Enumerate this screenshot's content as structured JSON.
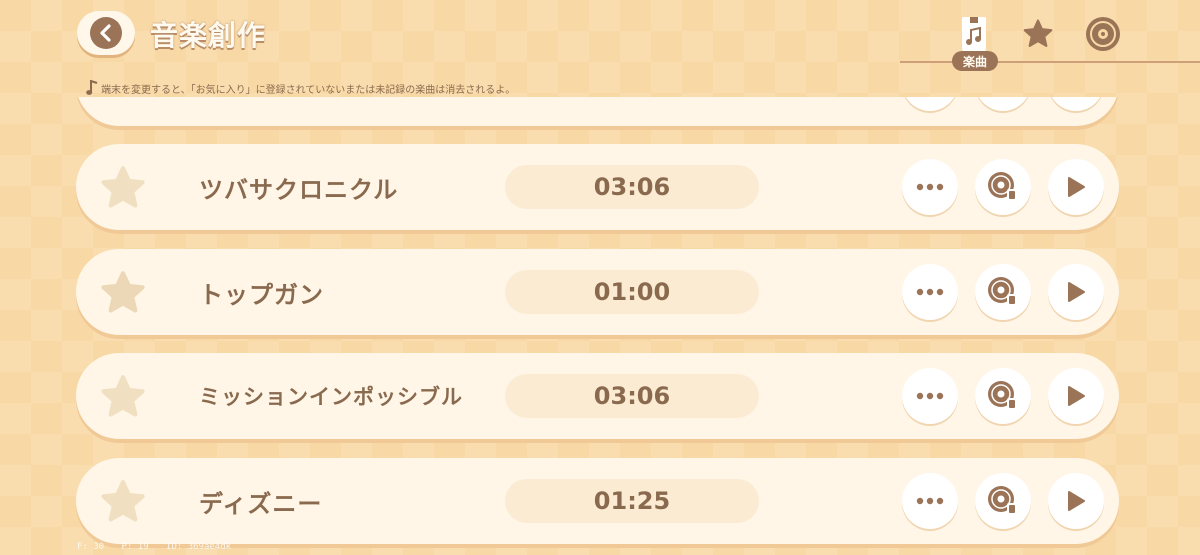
{
  "header": {
    "title": "音楽創作",
    "back_icon": "chevron-left-icon"
  },
  "tabs": [
    {
      "name": "songs",
      "icon": "music-file-icon",
      "label": "楽曲",
      "active": true
    },
    {
      "name": "favorites",
      "icon": "star-icon"
    },
    {
      "name": "records",
      "icon": "disc-icon"
    }
  ],
  "notice": "端末を変更すると、「お気に入り」に登録されていないまたは未記録の楽曲は消去されるよ。",
  "songs": [
    {
      "title": "",
      "time": ""
    },
    {
      "title": "ツバサクロニクル",
      "time": "03:06",
      "favorite": false
    },
    {
      "title": "トップガン",
      "time": "01:00",
      "favorite": false
    },
    {
      "title": "ミッションインポッシブル",
      "time": "03:06",
      "favorite": false
    },
    {
      "title": "ディズニー",
      "time": "01:25",
      "favorite": false
    }
  ],
  "debug": {
    "f": "F: 30",
    "p": "P: 19",
    "id": "ID: 369ae4dk"
  },
  "colors": {
    "accent": "#9b7458",
    "row_bg": "#fff6e7",
    "background": "#f8d9a6",
    "time_pill": "#faebd2",
    "star_inactive": "#f1dfc2"
  }
}
